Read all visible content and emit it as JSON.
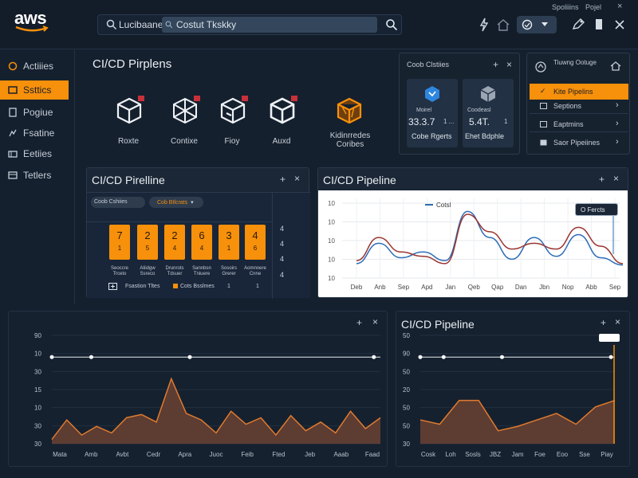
{
  "brand": {
    "logo": "aws",
    "accent": "#f7900b",
    "background": "#15202e"
  },
  "header": {
    "search_scope": "Lucibaane",
    "search_value": "Costut Tkskky",
    "mini_links": [
      "Spoliiins",
      "Pojel",
      "×"
    ],
    "icons": [
      "bolt-icon",
      "home-icon",
      "globe-icon",
      "chevron-down-icon",
      "settings-icon",
      "file-icon",
      "close-icon"
    ]
  },
  "sidebar": {
    "items": [
      {
        "label": "Actiiies",
        "icon": "activity-icon",
        "active": false
      },
      {
        "label": "Ssttics",
        "icon": "stats-icon",
        "active": true
      },
      {
        "label": "Pogiue",
        "icon": "page-icon",
        "active": false
      },
      {
        "label": "Fsatine",
        "icon": "feature-icon",
        "active": false
      },
      {
        "label": "Eetiies",
        "icon": "entity-icon",
        "active": false
      },
      {
        "label": "Tetlers",
        "icon": "table-icon",
        "active": false
      }
    ]
  },
  "pipelines": {
    "title": "CI/CD Pirplens",
    "services": [
      {
        "label": "Roxte",
        "icon": "box-cube-icon"
      },
      {
        "label": "Contixe",
        "icon": "network-cube-icon"
      },
      {
        "label": "Fioy",
        "icon": "flow-cube-icon"
      },
      {
        "label": "Auxd",
        "icon": "deploy-cube-icon"
      },
      {
        "label": "Kidinrredes Coribes",
        "icon": "orange-cube-icon"
      }
    ]
  },
  "code_cards": {
    "title": "Coob Clstiies",
    "controls": [
      "+",
      "×"
    ],
    "cards": [
      {
        "label": "Cobe Rgerts",
        "line1": "Moirel",
        "line2": "33.3.7",
        "line3": "1 ..."
      },
      {
        "label": "Ehet Bdphle",
        "line1": "Coodeasl",
        "line2": "5.4T.",
        "line3": "1"
      }
    ]
  },
  "right_menu": {
    "header": "Tiuwng Ootuge",
    "items": [
      {
        "label": "Kite Pipelins",
        "mark": "✓",
        "active": true
      },
      {
        "label": "Septions",
        "mark": "›",
        "active": false
      },
      {
        "label": "Eaptmins",
        "mark": "›",
        "active": false
      },
      {
        "label": "Saor Pipeiines",
        "mark": "›",
        "active": false
      }
    ]
  },
  "build_panel": {
    "title": "CI/CD Pirelline",
    "controls": [
      "+",
      "×"
    ],
    "chips": [
      "Coob Cshiies",
      "Cob Btlcrats"
    ],
    "boxes": [
      {
        "n1": "7",
        "n2": "1",
        "cap": "Seoccre Trceto"
      },
      {
        "n1": "2",
        "n2": "5",
        "cap": "Atiidgw Ssreco"
      },
      {
        "n1": "2",
        "n2": "4",
        "cap": "Drunrots Tdsuer"
      },
      {
        "n1": "6",
        "n2": "4",
        "cap": "Sannbsn Tniuere"
      },
      {
        "n1": "3",
        "n2": "1",
        "cap": "Sosoirs Grerer"
      },
      {
        "n1": "4",
        "n2": "6",
        "cap": "Aomnnere Cnne"
      }
    ],
    "side_marks": [
      "4",
      "4",
      "4",
      "4"
    ],
    "footer": {
      "left": "Fsastion Tltes",
      "mid": "Cots Bsslmes",
      "right_a": "1",
      "right_b": "1"
    }
  },
  "line_panel": {
    "title": "CI/CD Pipeline",
    "controls": [
      "+",
      "×"
    ],
    "tooltip": "O Fercts"
  },
  "area_panel_left": {
    "controls": [
      "+",
      "×"
    ]
  },
  "area_panel_right": {
    "title": "CI/CD Pipeline",
    "controls": [
      "+",
      "×"
    ]
  },
  "chart_data": [
    {
      "type": "line",
      "legend": [
        "Cotsl"
      ],
      "yticks": [
        "10",
        "10",
        "10",
        "10",
        "10"
      ],
      "categories": [
        "Deb",
        "Anb",
        "Sep",
        "Apd",
        "Jan",
        "Qeb",
        "Qap",
        "Dan",
        "Jbn",
        "Nop",
        "Abb",
        "Sep"
      ],
      "series": [
        {
          "name": "Cotsl",
          "color": "#2d6db7",
          "values": [
            10,
            24,
            14,
            18,
            12,
            46,
            28,
            13,
            28,
            15,
            30,
            14,
            9
          ]
        },
        {
          "name": "",
          "color": "#9a3530",
          "values": [
            12,
            28,
            18,
            15,
            10,
            44,
            32,
            20,
            24,
            20,
            35,
            22,
            10
          ]
        }
      ],
      "ylim": [
        0,
        55
      ]
    },
    {
      "type": "area",
      "yticks": [
        "90",
        "10",
        "30",
        "15",
        "10",
        "30",
        "30"
      ],
      "categories": [
        "Mata",
        "Amb",
        "Avbt",
        "Cedr",
        "Apra",
        "Juoc",
        "Feib",
        "Fted",
        "Jeb",
        "Aaab",
        "Faad"
      ],
      "reference_line": 80,
      "values": [
        4,
        22,
        8,
        16,
        10,
        24,
        27,
        20,
        60,
        28,
        22,
        10,
        30,
        18,
        24,
        8,
        26,
        12,
        20,
        10,
        30,
        14,
        24
      ],
      "ylim": [
        0,
        100
      ],
      "color": "#6a4132"
    },
    {
      "type": "area",
      "yticks": [
        "50",
        "90",
        "50",
        "20",
        "50",
        "50",
        "30"
      ],
      "categories": [
        "Cosk",
        "Loh",
        "Sosls",
        "JBZ",
        "Jam",
        "Foe",
        "Eoo",
        "Sse",
        "Piay"
      ],
      "reference_line": 80,
      "values": [
        22,
        18,
        40,
        40,
        12,
        16,
        22,
        28,
        18,
        34,
        40
      ],
      "ylim": [
        0,
        100
      ],
      "color": "#6a4132"
    }
  ]
}
